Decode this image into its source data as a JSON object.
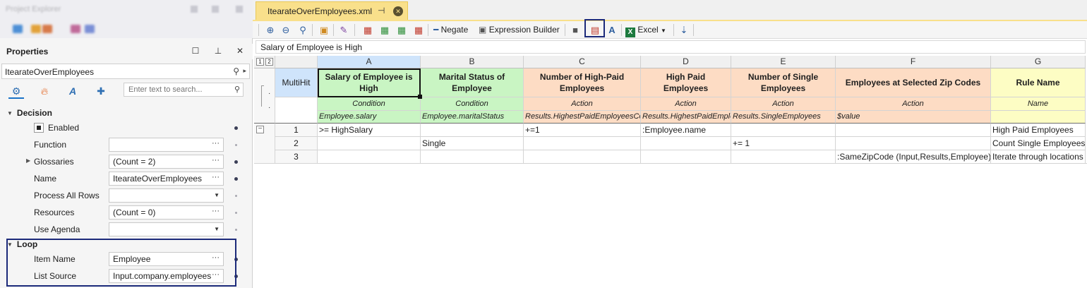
{
  "project_explorer": {
    "title": "Project Explorer"
  },
  "properties": {
    "title": "Properties",
    "object_name": "ItearateOverEmployees",
    "search_placeholder": "Enter text to search...",
    "sections": {
      "decision": "Decision",
      "loop": "Loop"
    },
    "rows": {
      "enabled": {
        "label": "Enabled"
      },
      "function": {
        "label": "Function",
        "value": ""
      },
      "glossaries": {
        "label": "Glossaries",
        "value": "(Count = 2)"
      },
      "name": {
        "label": "Name",
        "value": "ItearateOverEmployees"
      },
      "process_all_rows": {
        "label": "Process All Rows",
        "value": ""
      },
      "resources": {
        "label": "Resources",
        "value": "(Count = 0)"
      },
      "use_agenda": {
        "label": "Use Agenda",
        "value": ""
      },
      "item_name": {
        "label": "Item Name",
        "value": "Employee"
      },
      "list_source": {
        "label": "List Source",
        "value": "Input.company.employees"
      }
    }
  },
  "editor": {
    "tab_name": "ItearateOverEmployees.xml",
    "toolbar": {
      "negate": "Negate",
      "expression_builder": "Expression Builder",
      "excel": "Excel"
    },
    "formula": "Salary of Employee is High",
    "group_buttons": [
      "1",
      "2"
    ],
    "multihit": "MultiHit",
    "columns": [
      {
        "letter": "A",
        "header": "Salary of Employee is High",
        "type": "Condition",
        "expr": "Employee.salary"
      },
      {
        "letter": "B",
        "header": "Marital Status of Employee",
        "type": "Condition",
        "expr": "Employee.maritalStatus"
      },
      {
        "letter": "C",
        "header": "Number of High-Paid Employees",
        "type": "Action",
        "expr": "Results.HighestPaidEmployeesCoun"
      },
      {
        "letter": "D",
        "header": "High Paid Employees",
        "type": "Action",
        "expr": "Results.HighestPaidEmploy"
      },
      {
        "letter": "E",
        "header": "Number of Single Employees",
        "type": "Action",
        "expr": "Results.SingleEmployees"
      },
      {
        "letter": "F",
        "header": "Employees at Selected Zip Codes",
        "type": "Action",
        "expr": "$value"
      },
      {
        "letter": "G",
        "header": "Rule Name",
        "type": "Name",
        "expr": ""
      }
    ],
    "rows": [
      {
        "num": "1",
        "cells": [
          ">= HighSalary",
          "",
          "+=1",
          ":Employee.name",
          "",
          "",
          "High Paid Employees"
        ]
      },
      {
        "num": "2",
        "cells": [
          "",
          "Single",
          "",
          "",
          "+= 1",
          "",
          "Count Single Employees"
        ]
      },
      {
        "num": "3",
        "cells": [
          "",
          "",
          "",
          "",
          "",
          ":SameZipCode (Input,Results,Employee)",
          "Iterate through locations"
        ]
      }
    ]
  },
  "colors": {
    "condition": "#c9f5c3",
    "action": "#fddcc4",
    "name": "#fdfdc4",
    "tab": "#f9e08b",
    "highlight_box": "#1c2a7a"
  }
}
